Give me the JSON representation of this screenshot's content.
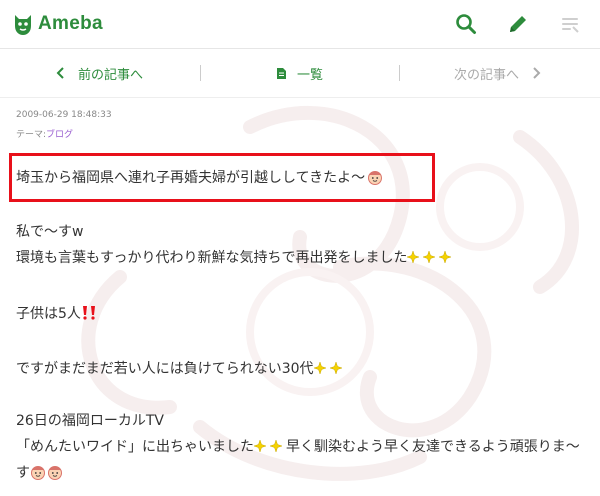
{
  "header": {
    "logo_text": "Ameba",
    "icons": [
      "search-icon",
      "pencil-icon",
      "menu-list-icon"
    ]
  },
  "nav": {
    "prev_label": "前の記事へ",
    "list_label": "一覧",
    "next_label": "次の記事へ"
  },
  "entry": {
    "date": "2009-06-29 18:48:33",
    "theme_prefix": "テーマ:",
    "theme_name": "ブログ",
    "title_line": "埼玉から福岡県へ連れ子再婚夫婦が引越ししてきたよ〜",
    "body": {
      "l1": "私で〜すw",
      "l2": "環境も言葉もすっかり代わり新鮮な気持ちで再出発をしました",
      "l3": "子供は5人",
      "l4": "ですがまだまだ若い人には負けてられない30代",
      "l5": "26日の福岡ローカルTV",
      "l6a": "「めんたいワイド」に出ちゃいました",
      "l6b": "早く馴染むよう早く友達できるよう頑張りま〜",
      "l7": "す"
    }
  },
  "colors": {
    "brand_green": "#2d8c3c",
    "highlight_red": "#e8101a",
    "theme_link": "#9a5fd0"
  }
}
